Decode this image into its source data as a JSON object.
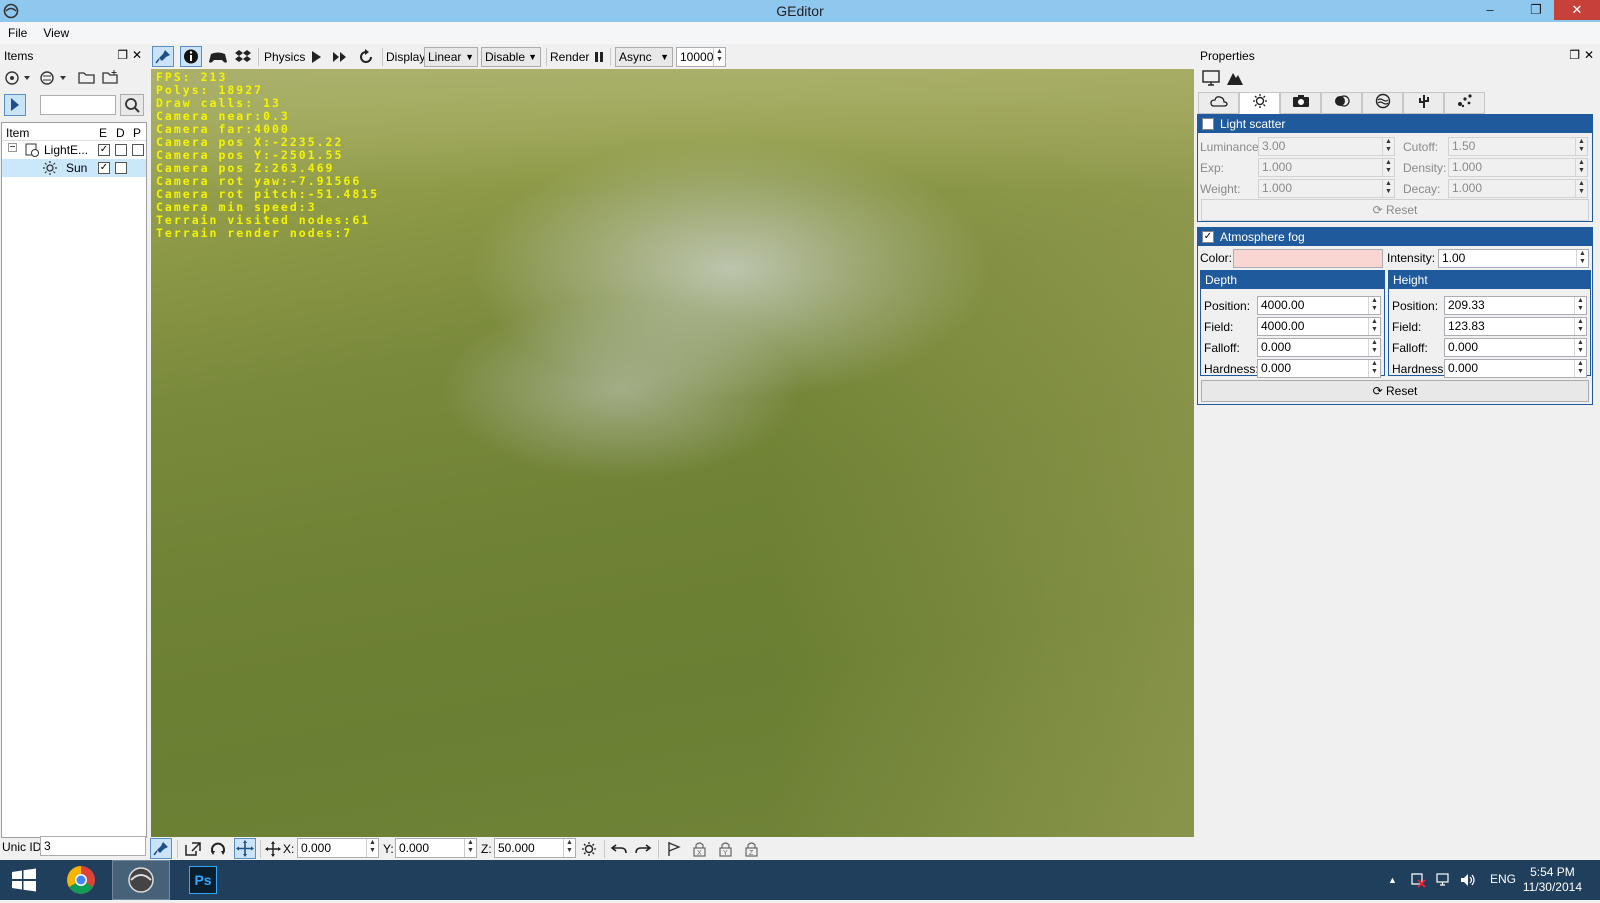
{
  "window": {
    "title": "GEditor",
    "minimize": "–",
    "restore": "❐",
    "close": "✕"
  },
  "menu": [
    "File",
    "View"
  ],
  "items_panel": {
    "title": "Items",
    "search_value": "",
    "columns": {
      "item": "Item",
      "e": "E",
      "d": "D",
      "p": "P"
    },
    "rows": [
      {
        "label": "LightE...",
        "e": true,
        "d": false,
        "p": false
      },
      {
        "label": "Sun",
        "e": true,
        "d": false
      }
    ],
    "unic_label": "Unic ID:",
    "unic_value": "3"
  },
  "toolbar": {
    "physics_label": "Physics",
    "display_label": "Display",
    "display_value": "Linear",
    "disable_value": "Disable",
    "render_label": "Render",
    "async_value": "Async",
    "count_value": "10000"
  },
  "stats": [
    "FPS: 213",
    "Polys: 18927",
    "Draw calls: 13",
    "Camera near:0.3",
    "Camera far:4000",
    "Camera pos X:-2235.22",
    "Camera pos Y:-2501.55",
    "Camera pos Z:263.469",
    "Camera rot yaw:-7.91566",
    "Camera rot pitch:-51.4815",
    "Camera min speed:3",
    "Terrain visited nodes:61",
    "Terrain render nodes:7"
  ],
  "bottom": {
    "x_label": "X:",
    "x_value": "0.000",
    "y_label": "Y:",
    "y_value": "0.000",
    "z_label": "Z:",
    "z_value": "50.000"
  },
  "properties": {
    "title": "Properties",
    "light_scatter": {
      "title": "Light scatter",
      "enabled": false,
      "luminance_label": "Luminance:",
      "luminance": "3.00",
      "cutoff_label": "Cutoff:",
      "cutoff": "1.50",
      "exp_label": "Exp:",
      "exp": "1.000",
      "density_label": "Density:",
      "density": "1.000",
      "weight_label": "Weight:",
      "weight": "1.000",
      "decay_label": "Decay:",
      "decay": "1.000",
      "reset": "Reset"
    },
    "atmosphere_fog": {
      "title": "Atmosphere fog",
      "enabled": true,
      "color_label": "Color:",
      "intensity_label": "Intensity:",
      "intensity": "1.00",
      "depth": {
        "title": "Depth",
        "position_label": "Position:",
        "position": "4000.00",
        "field_label": "Field:",
        "field": "4000.00",
        "falloff_label": "Falloff:",
        "falloff": "0.000",
        "hardness_label": "Hardness:",
        "hardness": "0.000"
      },
      "height": {
        "title": "Height",
        "position_label": "Position:",
        "position": "209.33",
        "field_label": "Field:",
        "field": "123.83",
        "falloff_label": "Falloff:",
        "falloff": "0.000",
        "hardness_label": "Hardness:",
        "hardness": "0.000"
      },
      "reset": "Reset"
    }
  },
  "taskbar": {
    "lang": "ENG",
    "time": "5:54 PM",
    "date": "11/30/2014",
    "ps_label": "Ps"
  },
  "colors": {
    "group_header": "#1f5b9c",
    "title_bar": "#8fc8ee",
    "taskbar": "#1f3f5c",
    "fog_color": "#f9d6d2",
    "stats_text": "#f4f400"
  }
}
